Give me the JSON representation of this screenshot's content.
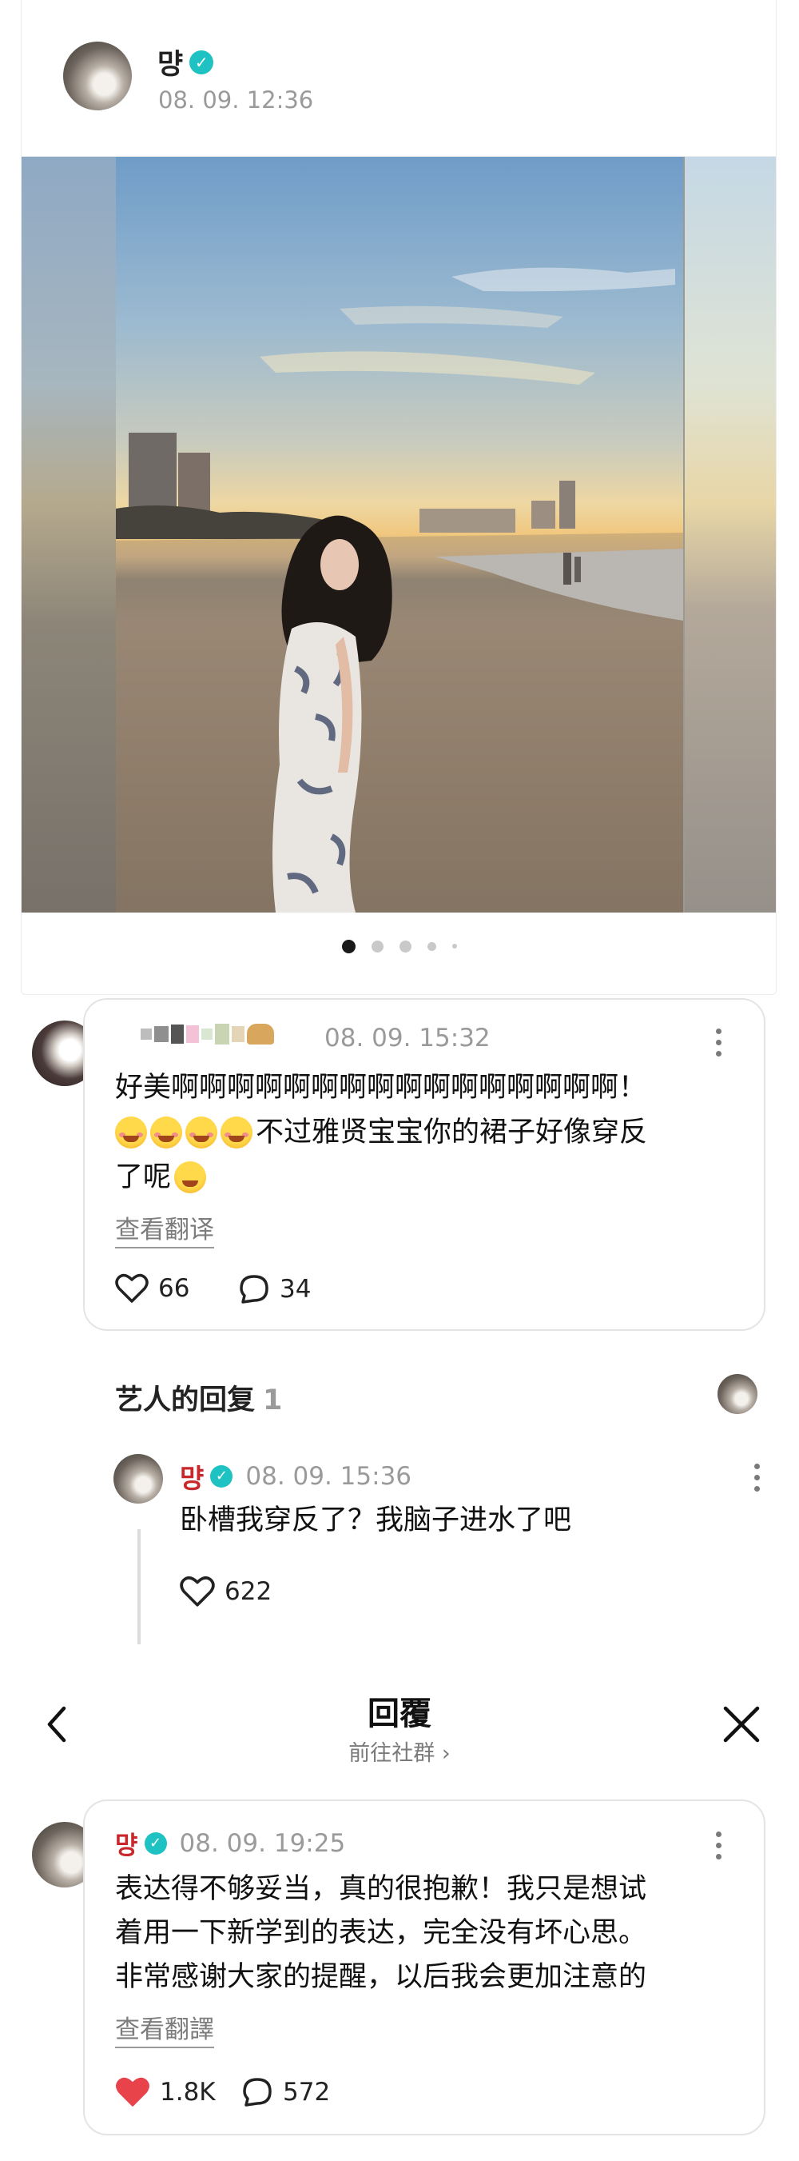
{
  "post": {
    "author": "먕",
    "timestamp": "08. 09. 12:36",
    "carousel_total": 5,
    "carousel_active": 1
  },
  "fan_comment": {
    "author_censored": "",
    "timestamp": "08. 09. 15:32",
    "text_line1": "好美啊啊啊啊啊啊啊啊啊啊啊啊啊啊啊啊！",
    "text_line2": "不过雅贤宝宝你的裙子好像穿反",
    "text_line3": "了呢",
    "translate": "查看翻译",
    "likes": "66",
    "replies": "34"
  },
  "artist_replies": {
    "title": "艺人的回复",
    "count": "1",
    "reply": {
      "author": "먕",
      "timestamp": "08. 09. 15:36",
      "text": "卧槽我穿反了？我脑子进水了吧",
      "likes": "622"
    }
  },
  "reply_sheet": {
    "title": "回覆",
    "subtitle": "前往社群 ›",
    "comment": {
      "author": "먕",
      "timestamp": "08. 09. 19:25",
      "line1": "表达得不够妥当，真的很抱歉！我只是想试",
      "line2": "着用一下新学到的表达，完全没有坏心思。",
      "line3": "非常感谢大家的提醒，以后我会更加注意的",
      "translate": "查看翻譯",
      "likes": "1.8K",
      "replies": "572"
    }
  },
  "colors": {
    "verified": "#1ec2c2",
    "artist_name": "#c8282c",
    "liked_heart": "#e8424b"
  }
}
